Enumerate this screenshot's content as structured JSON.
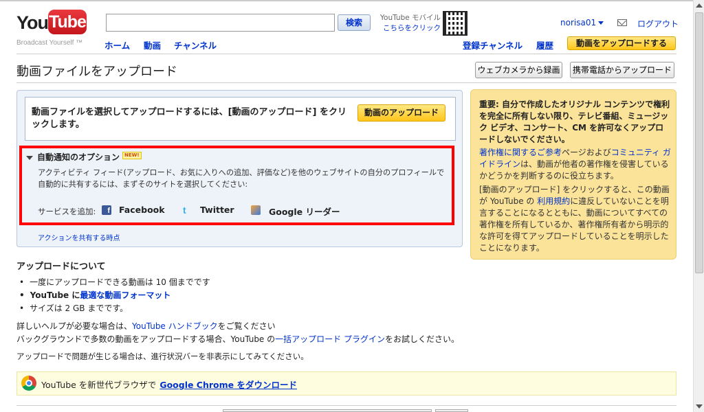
{
  "header": {
    "logo_you": "You",
    "logo_tube": "Tube",
    "tagline": "Broadcast Yourself ™",
    "search_value": "",
    "search_button": "検索",
    "mobile_line1": "YouTube モバイル",
    "mobile_line2": "こちらをクリック",
    "username": "norisa01",
    "logout": "ログアウト",
    "nav_home": "ホーム",
    "nav_videos": "動画",
    "nav_channels": "チャンネル",
    "nav_subscriptions": "登録チャンネル",
    "nav_history": "履歴",
    "upload_button": "動画をアップロードする"
  },
  "page": {
    "title": "動画ファイルをアップロード",
    "webcam_button": "ウェブカメラから録画",
    "mobile_upload_button": "携帯電話からアップロード"
  },
  "main": {
    "select_text": "動画ファイルを選択してアップロードするには、[動画のアップロード] をクリックします。",
    "upload_button": "動画のアップロード",
    "options_title": "自動通知のオプション",
    "new_badge": "NEW!",
    "options_desc": "アクティビティ フィード(アップロード、お気に入りへの追加、評価など)を他のウェブサイトの自分のプロフィールで自動的に共有するには、まずそのサイトを選択してください:",
    "service_label": "サービスを追加:",
    "services": [
      "Facebook",
      "Twitter",
      "Google リーダー"
    ],
    "share_link": "アクションを共有する時点"
  },
  "notice": {
    "bold_text": "重要: 自分で作成したオリジナル コンテンツで権利を完全に所有しない限り、テレビ番組、ミュージック ビデオ、コンサート、CM を許可なくアップロードしないでください。",
    "p1_link1": "著作権に関するご参考",
    "p1_mid": "ページおよび",
    "p1_link2": "コミュニティ ガイドライン",
    "p1_rest": "は、動画が他者の著作権を侵害しているかどうかを判断するのに役立ちます。",
    "p2_start": "[動画のアップロード] をクリックすると、この動画が YouTube の ",
    "p2_link": "利用規約",
    "p2_rest": "に違反していないことを明言することになるとともに、動画についてすべての著作権を所有しているか、著作権所有者から明示的な許可を得てアップロードしていることを明示したことになります。"
  },
  "about": {
    "title": "アップロードについて",
    "bullet1": "一度にアップロードできる動画は 10 個までです",
    "bullet2_prefix": "YouTube に",
    "bullet2_link": "最適な動画フォーマット",
    "bullet3": "サイズは 2 GB までです。",
    "help1_prefix": "詳しいヘルプが必要な場合は、",
    "help1_link": "YouTube ハンドブック",
    "help1_suffix": "をご覧ください",
    "help2_prefix": "バックグラウンドで多数の動画をアップロードする場合、YouTube の",
    "help2_link": "一括アップロード プラグイン",
    "help2_suffix": "をお試しください。",
    "progress_link": "アップロードで問題が生じる場合は、進行状況バーを非表示にしてみてください。"
  },
  "chrome_bar": {
    "text": "YouTube を新世代ブラウザで",
    "link": "Google Chrome をダウンロード"
  },
  "colors": {
    "link": "#0033cc",
    "highlight_border": "#ff0000",
    "notice_bg": "#fbe39a",
    "panel_bg": "#eef3fa",
    "brand_red": "#cc181e"
  }
}
